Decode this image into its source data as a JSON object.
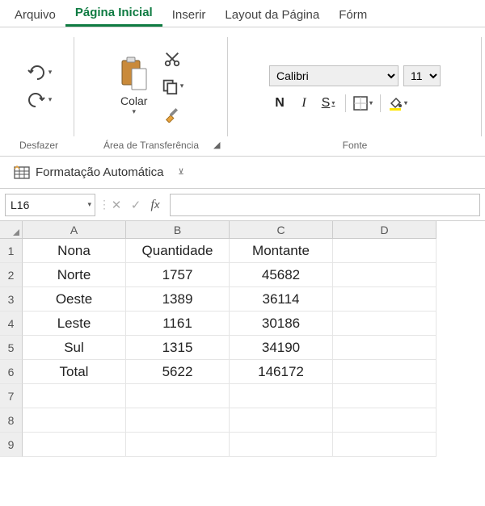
{
  "tabs": {
    "file": "Arquivo",
    "home": "Página Inicial",
    "insert": "Inserir",
    "layout": "Layout da Página",
    "formulas": "Fórm"
  },
  "ribbon": {
    "undo_group": "Desfazer",
    "clipboard_group": "Área de Transferência",
    "paste": "Colar",
    "font_group": "Fonte",
    "font_name": "Calibri",
    "font_size": "11",
    "bold": "N",
    "italic": "I",
    "underline": "S"
  },
  "qat": {
    "autoformat": "Formatação Automática"
  },
  "fxrow": {
    "name": "L16"
  },
  "columns": [
    "A",
    "B",
    "C",
    "D"
  ],
  "rows": [
    "1",
    "2",
    "3",
    "4",
    "5",
    "6",
    "7",
    "8",
    "9"
  ],
  "cells": {
    "A1": "Nona",
    "B1": "Quantidade",
    "C1": "Montante",
    "A2": "Norte",
    "B2": "1757",
    "C2": "45682",
    "A3": "Oeste",
    "B3": "1389",
    "C3": "36114",
    "A4": "Leste",
    "B4": "1161",
    "C4": "30186",
    "A5": "Sul",
    "B5": "1315",
    "C5": "34190",
    "A6": "Total",
    "B6": "5622",
    "C6": "146172"
  }
}
